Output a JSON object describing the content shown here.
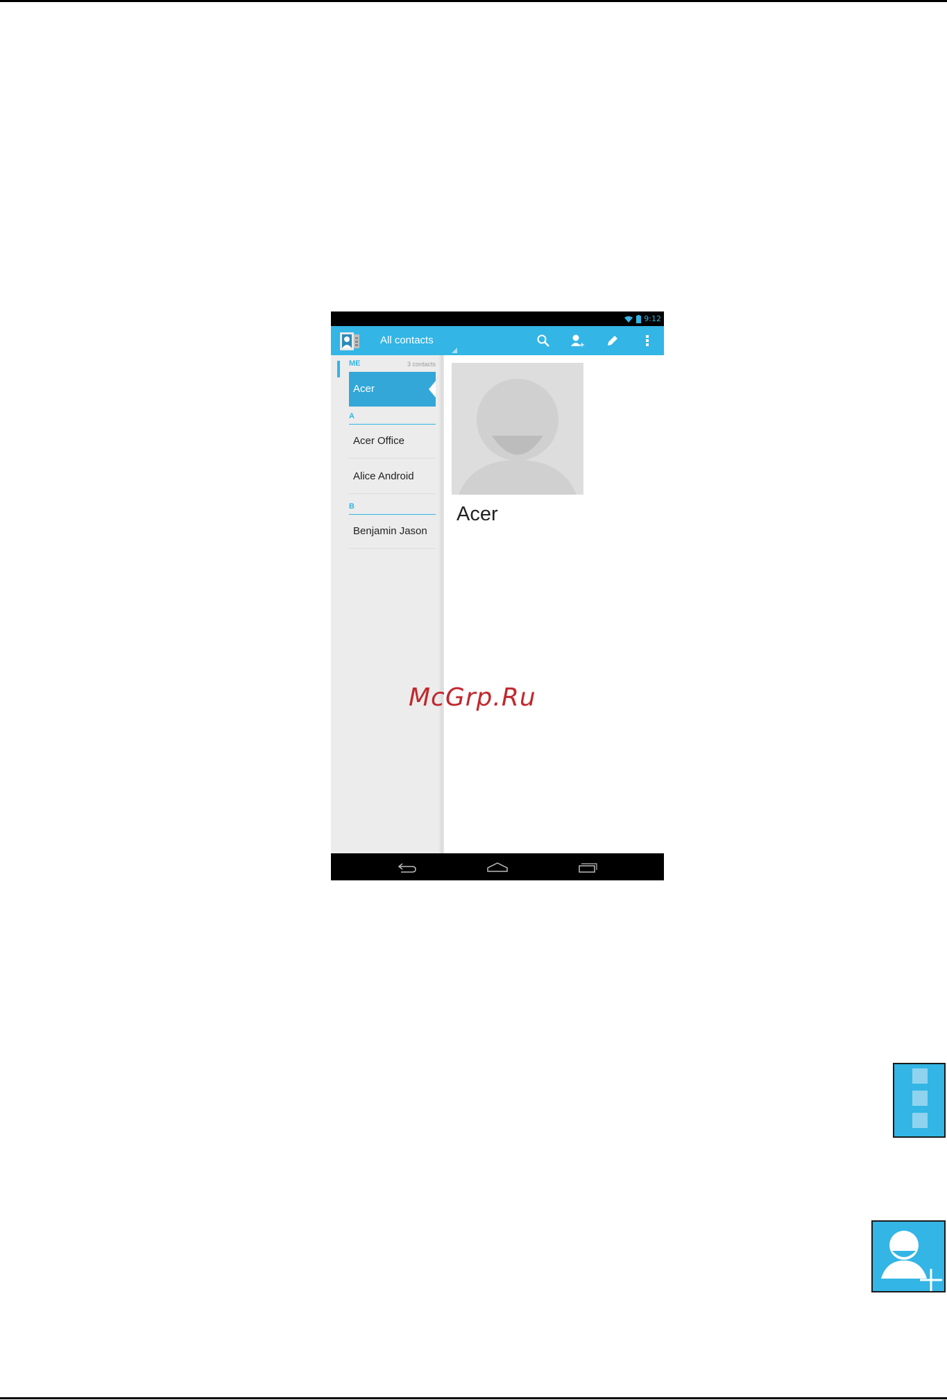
{
  "status_bar": {
    "time": "9:12"
  },
  "action_bar": {
    "title": "All contacts",
    "icons": [
      "contacts-app-icon",
      "search-icon",
      "add-contact-icon",
      "edit-icon",
      "overflow-menu-icon"
    ]
  },
  "contact_list": {
    "me_header": "ME",
    "contact_count": "3 contacts",
    "me_entry": "Acer",
    "sections": [
      {
        "letter": "A",
        "contacts": [
          "Acer Office",
          "Alice Android"
        ]
      },
      {
        "letter": "B",
        "contacts": [
          "Benjamin Jason"
        ]
      }
    ]
  },
  "detail": {
    "name": "Acer"
  },
  "nav_bar": {
    "icons": [
      "back-icon",
      "home-icon",
      "recent-apps-icon"
    ]
  },
  "watermark": "McGrp.Ru",
  "callouts": [
    "overflow-menu-icon",
    "add-contact-icon"
  ],
  "colors": {
    "accent": "#33b5e5",
    "selected": "#33a7d8",
    "watermark": "#c0282d"
  }
}
